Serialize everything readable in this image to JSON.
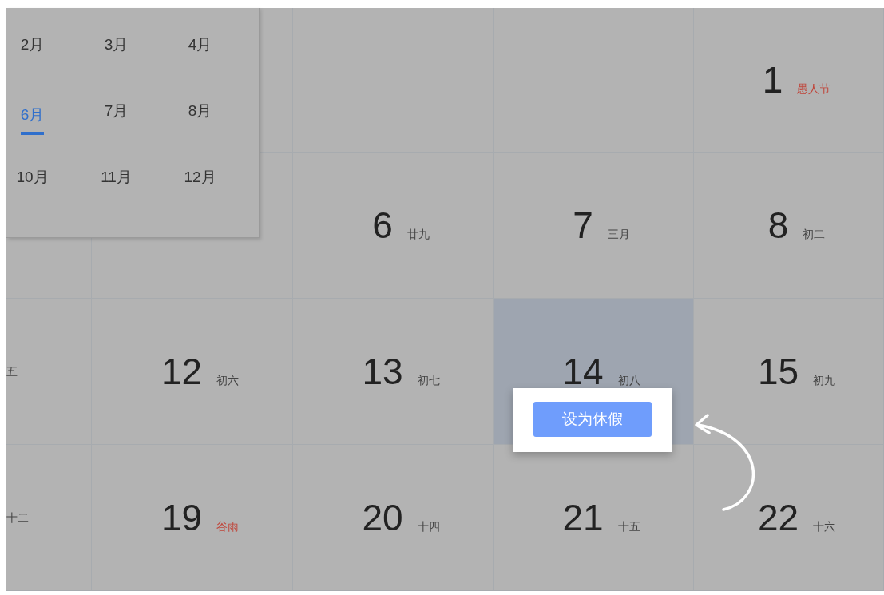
{
  "month_picker": {
    "months": [
      {
        "label": "2月",
        "selected": false
      },
      {
        "label": "3月",
        "selected": false
      },
      {
        "label": "4月",
        "selected": false
      },
      {
        "label": "6月",
        "selected": true
      },
      {
        "label": "7月",
        "selected": false
      },
      {
        "label": "8月",
        "selected": false
      },
      {
        "label": "10月",
        "selected": false
      },
      {
        "label": "11月",
        "selected": false
      },
      {
        "label": "12月",
        "selected": false
      }
    ]
  },
  "calendar": {
    "rows": [
      [
        {},
        {},
        {},
        {},
        {
          "day": "1",
          "lunar": "愚人节",
          "kind": "holiday",
          "selected": false
        }
      ],
      [
        {},
        {},
        {
          "day": "6",
          "lunar": "廿九",
          "kind": "normal",
          "selected": false
        },
        {
          "day": "7",
          "lunar": "三月",
          "kind": "normal",
          "selected": false
        },
        {
          "day": "8",
          "lunar": "初二",
          "kind": "normal",
          "selected": false
        }
      ],
      [
        {
          "lunar": "五",
          "kind": "edge",
          "selected": false
        },
        {
          "day": "12",
          "lunar": "初六",
          "kind": "normal",
          "selected": false
        },
        {
          "day": "13",
          "lunar": "初七",
          "kind": "normal",
          "selected": false
        },
        {
          "day": "14",
          "lunar": "初八",
          "kind": "normal",
          "selected": true
        },
        {
          "day": "15",
          "lunar": "初九",
          "kind": "normal",
          "selected": false
        }
      ],
      [
        {
          "lunar": "十二",
          "kind": "edge",
          "selected": false
        },
        {
          "day": "19",
          "lunar": "谷雨",
          "kind": "holiday",
          "selected": false
        },
        {
          "day": "20",
          "lunar": "十四",
          "kind": "normal",
          "selected": false
        },
        {
          "day": "21",
          "lunar": "十五",
          "kind": "normal",
          "selected": false
        },
        {
          "day": "22",
          "lunar": "十六",
          "kind": "normal",
          "selected": false
        }
      ]
    ]
  },
  "popup": {
    "button": "设为休假"
  }
}
